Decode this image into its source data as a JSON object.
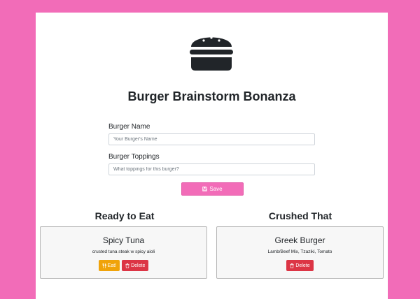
{
  "app": {
    "title": "Burger Brainstorm Bonanza"
  },
  "form": {
    "name_label": "Burger Name",
    "name_placeholder": "Your Burger's Name",
    "toppings_label": "Burger Toppings",
    "toppings_placeholder": "What toppings for this burger?",
    "save_label": "Save"
  },
  "ready": {
    "heading": "Ready to Eat",
    "items": [
      {
        "name": "Spicy Tuna",
        "toppings": "crusted tuna steak w spicy aioli",
        "eat_label": "Eat!",
        "delete_label": "Delete"
      }
    ]
  },
  "crushed": {
    "heading": "Crushed That",
    "items": [
      {
        "name": "Greek Burger",
        "toppings": "Lamb/Beef Mix, Tzaziki, Tomato",
        "delete_label": "Delete"
      }
    ]
  },
  "icons": {
    "logo": "hamburger-icon",
    "save": "floppy-disk-icon",
    "eat": "utensils-icon",
    "delete": "trash-icon"
  },
  "colors": {
    "brand_pink": "#f26cb8",
    "eat_orange": "#f0a30a",
    "delete_red": "#dc3545"
  }
}
